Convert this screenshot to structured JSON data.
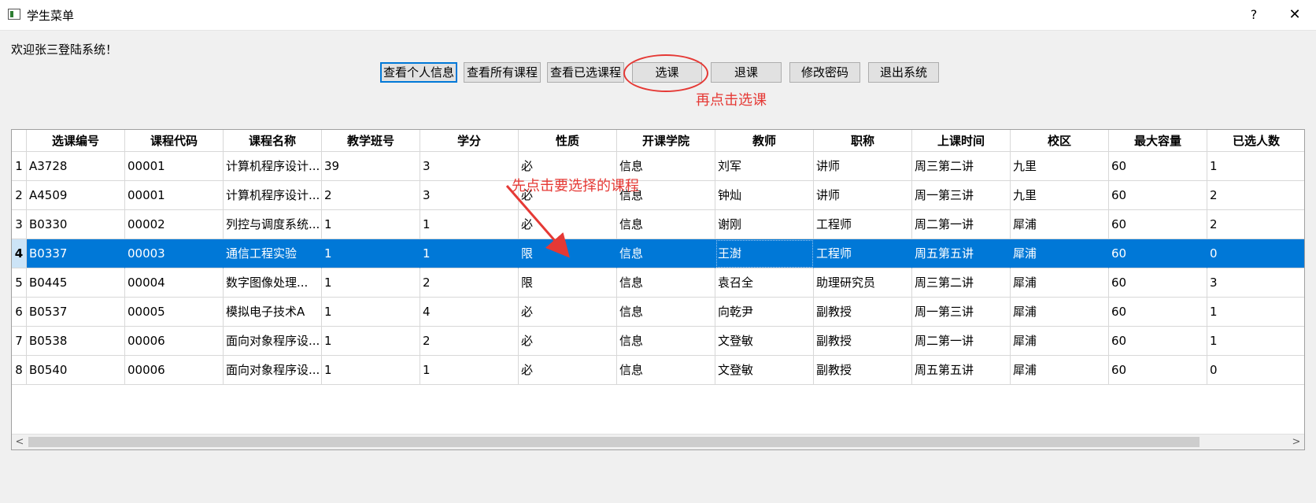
{
  "window": {
    "title": "学生菜单",
    "help_glyph": "?",
    "close_glyph": "✕"
  },
  "welcome_text": "欢迎张三登陆系统！",
  "toolbar": {
    "view_personal_info": "查看个人信息",
    "view_all_courses": "查看所有课程",
    "view_selected_courses": "查看已选课程",
    "select_course": "选课",
    "drop_course": "退课",
    "change_password": "修改密码",
    "exit_system": "退出系统"
  },
  "annotations": {
    "step1": "先点击要选择的课程",
    "step2": "再点击选课",
    "color": "#e53935"
  },
  "table": {
    "headers": [
      "选课编号",
      "课程代码",
      "课程名称",
      "教学班号",
      "学分",
      "性质",
      "开课学院",
      "教师",
      "职称",
      "上课时间",
      "校区",
      "最大容量",
      "已选人数"
    ],
    "row_numbers": [
      "1",
      "2",
      "3",
      "4",
      "5",
      "6",
      "7",
      "8"
    ],
    "selected_row": 3,
    "rows": [
      [
        "A3728",
        "00001",
        "计算机程序设计...",
        "39",
        "3",
        "必",
        "信息",
        "刘军",
        "讲师",
        "周三第二讲",
        "九里",
        "60",
        "1"
      ],
      [
        "A4509",
        "00001",
        "计算机程序设计...",
        "2",
        "3",
        "必",
        "信息",
        "钟灿",
        "讲师",
        "周一第三讲",
        "九里",
        "60",
        "2"
      ],
      [
        "B0330",
        "00002",
        "列控与调度系统...",
        "1",
        "1",
        "必",
        "信息",
        "谢刚",
        "工程师",
        "周二第一讲",
        "犀浦",
        "60",
        "2"
      ],
      [
        "B0337",
        "00003",
        "通信工程实验",
        "1",
        "1",
        "限",
        "信息",
        "王澍",
        "工程师",
        "周五第五讲",
        "犀浦",
        "60",
        "0"
      ],
      [
        "B0445",
        "00004",
        "数字图像处理...",
        "1",
        "2",
        "限",
        "信息",
        "袁召全",
        "助理研究员",
        "周三第二讲",
        "犀浦",
        "60",
        "3"
      ],
      [
        "B0537",
        "00005",
        "模拟电子技术A",
        "1",
        "4",
        "必",
        "信息",
        "向乾尹",
        "副教授",
        "周一第三讲",
        "犀浦",
        "60",
        "1"
      ],
      [
        "B0538",
        "00006",
        "面向对象程序设...",
        "1",
        "2",
        "必",
        "信息",
        "文登敏",
        "副教授",
        "周二第一讲",
        "犀浦",
        "60",
        "1"
      ],
      [
        "B0540",
        "00006",
        "面向对象程序设...",
        "1",
        "1",
        "必",
        "信息",
        "文登敏",
        "副教授",
        "周五第五讲",
        "犀浦",
        "60",
        "0"
      ]
    ]
  },
  "scrollbar": {
    "left_arrow": "<",
    "right_arrow": ">"
  },
  "colors": {
    "selection": "#0078d7",
    "focus_border": "#0078d7"
  }
}
